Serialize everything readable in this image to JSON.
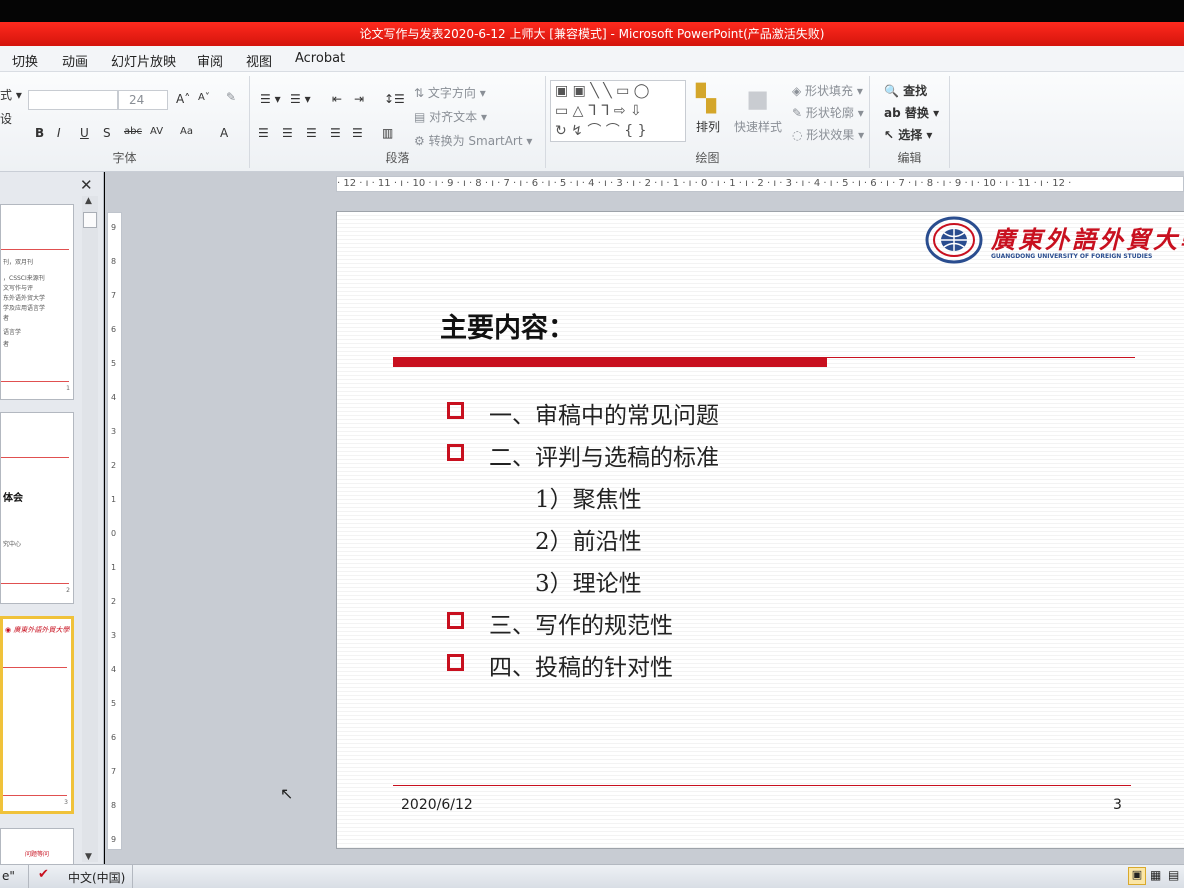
{
  "window": {
    "title": "论文写作与发表2020-6-12 上师大 [兼容模式] - Microsoft PowerPoint(产品激活失败)"
  },
  "menu": {
    "items": [
      "切换",
      "动画",
      "幻灯片放映",
      "审阅",
      "视图",
      "Acrobat"
    ]
  },
  "ribbon": {
    "font_group": {
      "label": "字体",
      "font_size": "24",
      "left_fragments": [
        "式 ▾",
        "设"
      ],
      "format_buttons": [
        "B",
        "I",
        "U",
        "S",
        "abc",
        "AV",
        "Aa",
        "A"
      ]
    },
    "paragraph_group": {
      "label": "段落",
      "text_direction": "文字方向",
      "align_text": "对齐文本",
      "smartart": "转换为 SmartArt"
    },
    "drawing_group": {
      "label": "绘图",
      "arrange": "排列",
      "quick_styles": "快速样式",
      "shape_fill": "形状填充",
      "shape_outline": "形状轮廓",
      "shape_effects": "形状效果"
    },
    "editing_group": {
      "label": "编辑",
      "find": "查找",
      "replace": "替换",
      "select": "选择"
    }
  },
  "ruler": {
    "horizontal_labels": "· 12 · ı · 11 · ı · 10 · ı · 9 · ı · 8 · ı · 7 · ı · 6 · ı · 5 · ı · 4 · ı · 3 · ı · 2 · ı · 1 · ı · 0 · ı · 1 · ı · 2 · ı · 3 · ı · 4 · ı · 5 · ı · 6 · ı · 7 · ı · 8 · ı · 9 · ı · 10 · ı · 11 · ı · 12 ·",
    "vertical_labels": [
      "9",
      "8",
      "7",
      "6",
      "5",
      "4",
      "3",
      "2",
      "1",
      "0",
      "1",
      "2",
      "3",
      "4",
      "5",
      "6",
      "7",
      "8",
      "9"
    ]
  },
  "thumbnails": {
    "slide1_lines": [
      "刊，双月刊",
      "，CSSCI来源刊",
      "文写作与评",
      "东外语外贸大学",
      "学及应用语言学",
      "者",
      "语言学",
      "者"
    ],
    "slide1_num": "1",
    "slide2_title": "体会",
    "slide2_sub": "究中心",
    "slide2_num": "2",
    "slide3_num": "3",
    "slide4_text": "问题等问"
  },
  "slide": {
    "logo_cn": "廣東外語外貿大學",
    "logo_en": "GUANGDONG UNIVERSITY OF FOREIGN STUDIES",
    "title": "主要内容：",
    "bullets": [
      {
        "text": "一、审稿中的常见问题",
        "marker": true
      },
      {
        "text": "二、评判与选稿的标准",
        "marker": true
      },
      {
        "text": "1）聚焦性",
        "marker": false
      },
      {
        "text": "2）前沿性",
        "marker": false
      },
      {
        "text": "3）理论性",
        "marker": false
      },
      {
        "text": "三、写作的规范性",
        "marker": true
      },
      {
        "text": "四、投稿的针对性",
        "marker": true
      }
    ],
    "date": "2020/6/12",
    "slide_number": "3"
  },
  "status_bar": {
    "left": "e\"",
    "ime": "中文(中国)"
  },
  "colors": {
    "title_bar": "#e3190f",
    "accent_red": "#c8101f"
  }
}
